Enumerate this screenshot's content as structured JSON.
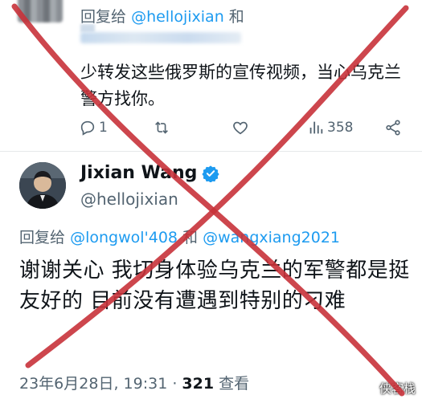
{
  "reply_tweet": {
    "reply_prefix": "回复给",
    "reply_to_handle": "@hellojixian",
    "reply_conj": "和",
    "text": "少转发这些俄罗斯的宣传视频，当心乌克兰警方找你。",
    "actions": {
      "replies": "1",
      "likes_icon": "heart-icon",
      "views": "358"
    }
  },
  "main_tweet": {
    "author_name": "Jixian Wang",
    "verified_icon": "verified-badge-icon",
    "author_handle": "@hellojixian",
    "reply_prefix": "回复给",
    "reply_to_1": "@longwol'408",
    "reply_conj": "和",
    "reply_to_2": "@wangxiang2021",
    "text": "谢谢关心 我切身体验乌克兰的军警都是挺友好的 目前没有遭遇到特别的刁难",
    "date": "23年6月28日, 19:31 · ",
    "views_count": "321",
    "views_label": " 查看"
  },
  "overlay": {
    "mark_color": "#c8323a"
  },
  "watermark": "侠客栈",
  "colors": {
    "link": "#1d9bf0",
    "secondary": "#536471"
  }
}
